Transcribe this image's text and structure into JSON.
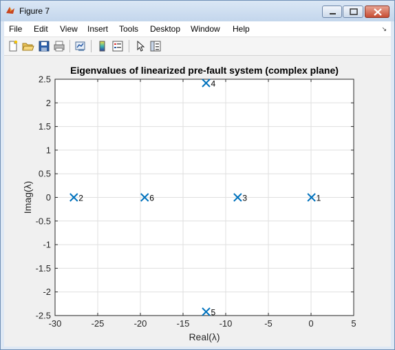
{
  "window": {
    "title": "Figure 7"
  },
  "menu": [
    "File",
    "Edit",
    "View",
    "Insert",
    "Tools",
    "Desktop",
    "Window",
    "Help"
  ],
  "toolbar": [
    "new-figure-icon",
    "open-file-icon",
    "save-icon",
    "print-icon",
    "link-plot-icon",
    "colorbar-icon",
    "legend-icon",
    "pointer-icon",
    "property-inspector-icon"
  ],
  "chart_data": {
    "type": "scatter",
    "title": "Eigenvalues of linearized pre-fault system (complex plane)",
    "xlabel": "Real(λ)",
    "ylabel": "Imag(λ)",
    "xlim": [
      -30,
      5
    ],
    "ylim": [
      -2.5,
      2.5
    ],
    "xticks": [
      "-30",
      "-25",
      "-20",
      "-15",
      "-10",
      "-5",
      "0",
      "5"
    ],
    "yticks": [
      "-2.5",
      "-2",
      "-1.5",
      "-1",
      "-0.5",
      "0",
      "0.5",
      "1",
      "1.5",
      "2",
      "2.5"
    ],
    "grid": true,
    "marker": "x",
    "marker_color": "#0072bd",
    "points": [
      {
        "label": "1",
        "x": 0.05,
        "y": 0
      },
      {
        "label": "2",
        "x": -27.8,
        "y": 0
      },
      {
        "label": "3",
        "x": -8.6,
        "y": 0
      },
      {
        "label": "4",
        "x": -12.3,
        "y": 2.42
      },
      {
        "label": "5",
        "x": -12.3,
        "y": -2.42
      },
      {
        "label": "6",
        "x": -19.5,
        "y": 0
      }
    ]
  }
}
